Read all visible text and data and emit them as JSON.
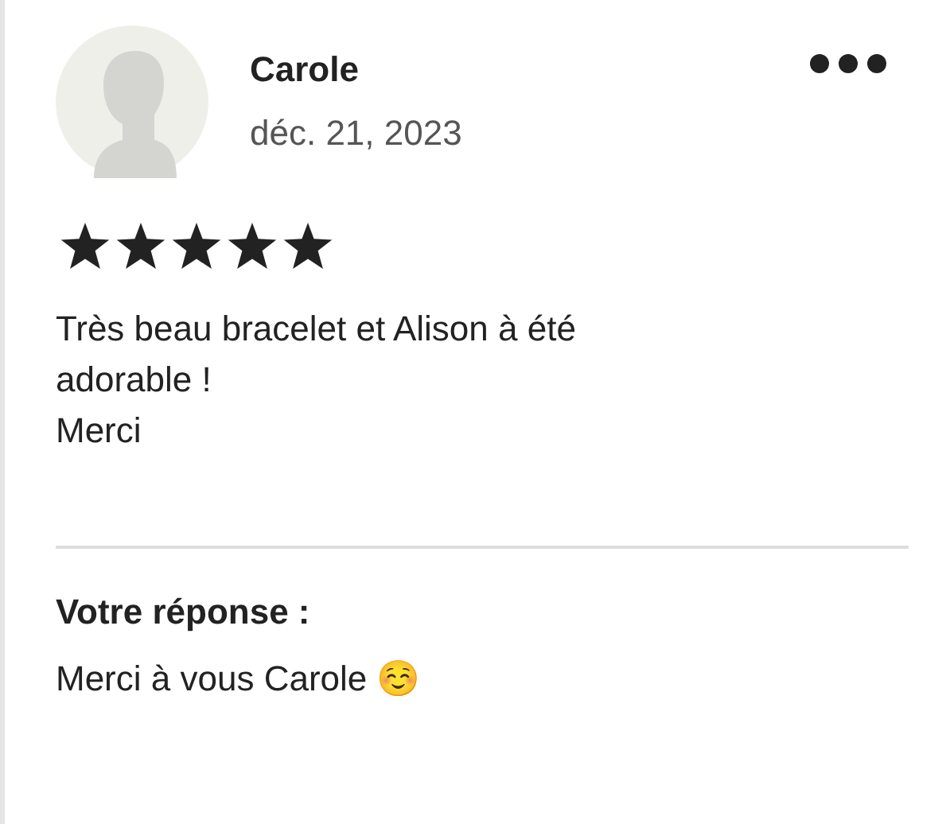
{
  "review": {
    "author": "Carole",
    "date": "déc. 21, 2023",
    "stars": 5,
    "text_lines": [
      "Très beau bracelet et Alison à été adorable !",
      "Merci"
    ]
  },
  "response": {
    "heading": "Votre réponse :",
    "text": "Merci à vous Carole ☺️"
  }
}
